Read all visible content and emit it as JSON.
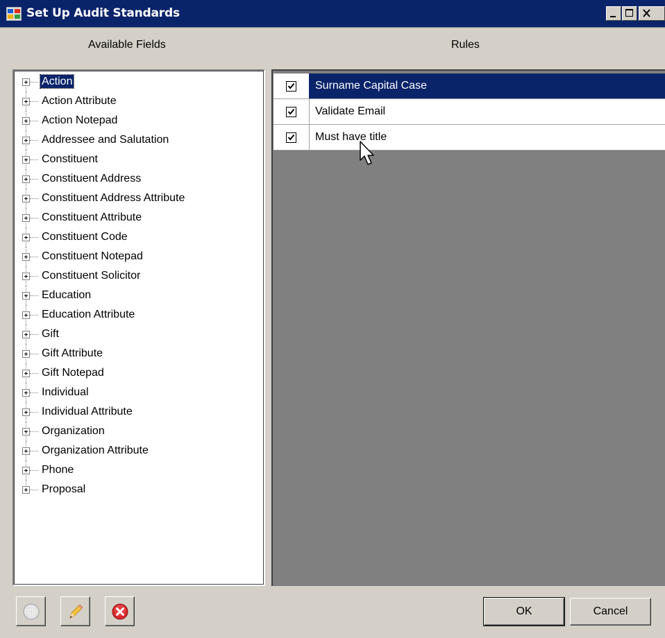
{
  "window": {
    "title": "Set Up Audit Standards"
  },
  "headers": {
    "available_fields": "Available Fields",
    "rules": "Rules"
  },
  "tree": {
    "items": [
      {
        "label": "Action",
        "selected": true
      },
      {
        "label": "Action Attribute"
      },
      {
        "label": "Action Notepad"
      },
      {
        "label": "Addressee and Salutation"
      },
      {
        "label": "Constituent"
      },
      {
        "label": "Constituent Address"
      },
      {
        "label": "Constituent Address Attribute"
      },
      {
        "label": "Constituent Attribute"
      },
      {
        "label": "Constituent Code"
      },
      {
        "label": "Constituent Notepad"
      },
      {
        "label": "Constituent Solicitor"
      },
      {
        "label": "Education"
      },
      {
        "label": "Education Attribute"
      },
      {
        "label": "Gift"
      },
      {
        "label": "Gift Attribute"
      },
      {
        "label": "Gift Notepad"
      },
      {
        "label": "Individual"
      },
      {
        "label": "Individual Attribute"
      },
      {
        "label": "Organization"
      },
      {
        "label": "Organization Attribute"
      },
      {
        "label": "Phone"
      },
      {
        "label": "Proposal"
      }
    ]
  },
  "rules": [
    {
      "name": "Surname Capital Case",
      "checked": true,
      "selected": true
    },
    {
      "name": "Validate Email",
      "checked": true
    },
    {
      "name": "Must have title",
      "checked": true
    }
  ],
  "toolbar": {
    "add_icon": "add-icon",
    "edit_icon": "pencil-icon",
    "delete_icon": "delete-icon"
  },
  "buttons": {
    "ok": "OK",
    "cancel": "Cancel"
  },
  "colors": {
    "titlebar": "#0a246a",
    "selection": "#0a246a",
    "window_bg": "#d4d0c8",
    "grid_empty": "#808080"
  }
}
